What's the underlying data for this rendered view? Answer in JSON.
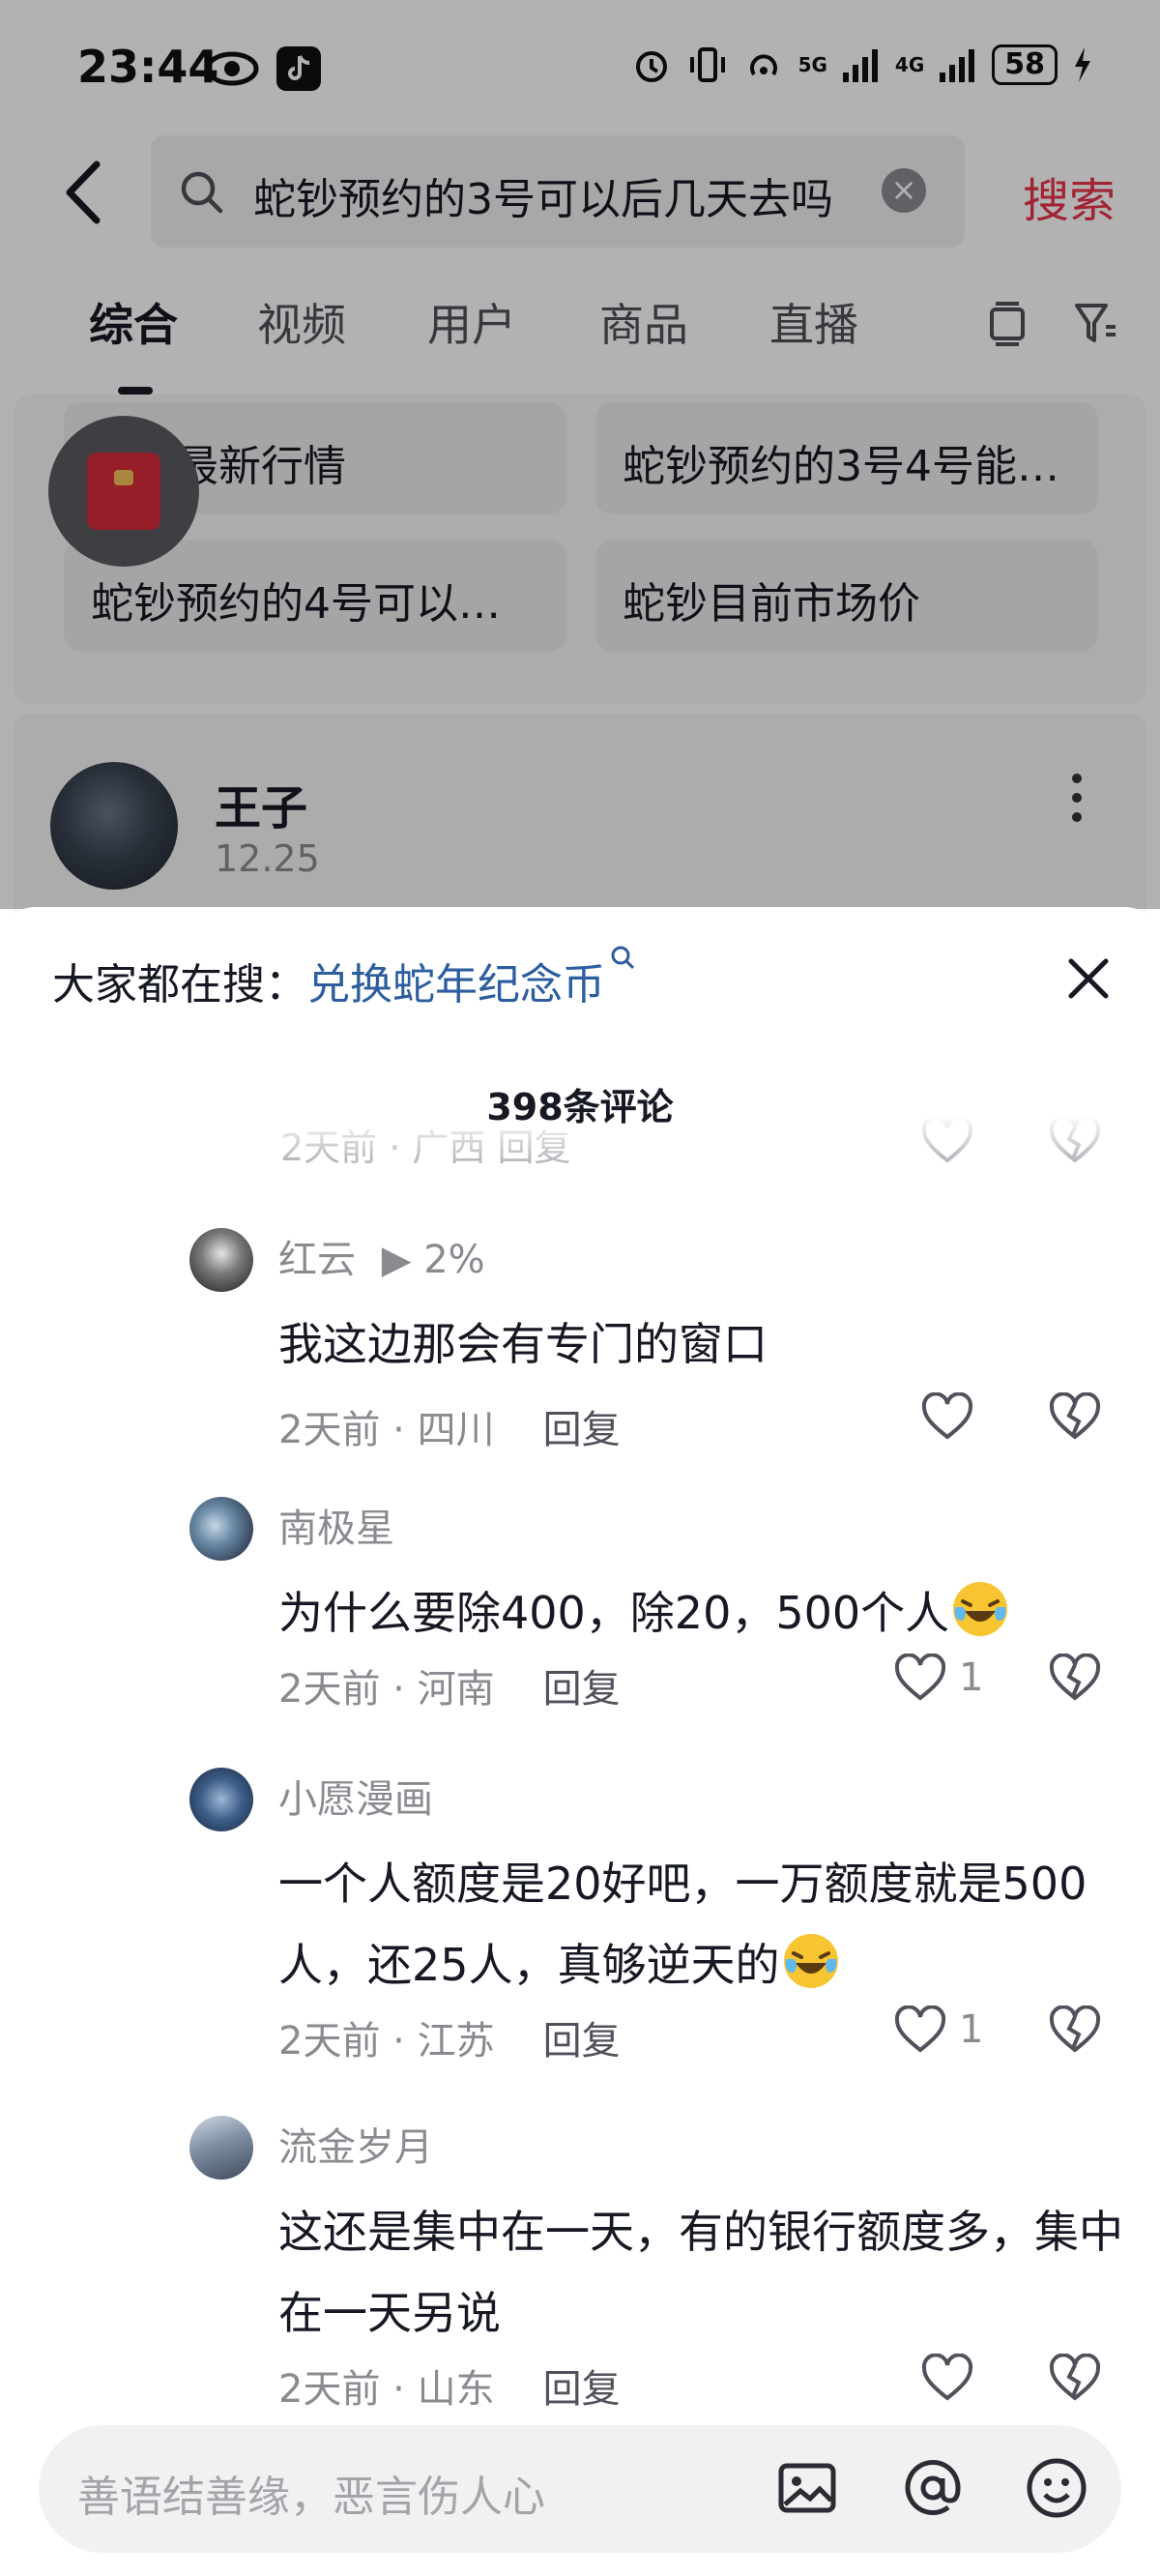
{
  "status_bar": {
    "time": "23:44",
    "battery": "58",
    "icons": [
      "eye-icon",
      "tiktok-icon",
      "alarm-icon",
      "vibrate-icon",
      "hotspot-icon",
      "signal-5g-icon",
      "signal-4g-icon",
      "charging-icon"
    ],
    "net1": "5G",
    "net2": "4G"
  },
  "search": {
    "query": "蛇钞预约的3号可以后几天去吗",
    "button": "搜索"
  },
  "tabs": [
    "综合",
    "视频",
    "用户",
    "商品",
    "直播"
  ],
  "suggestions": [
    "蛇币最新行情",
    "蛇钞预约的3号4号能…",
    "蛇钞预约的4号可以…",
    "蛇钞目前市场价"
  ],
  "post": {
    "author": "王子",
    "date": "12.25"
  },
  "sheet": {
    "trending_prefix": "大家都在搜：",
    "trending_link": "兑换蛇年纪念币",
    "comment_count": "398条评论",
    "ghost_meta": "2天前 · 广西    回复",
    "comments": [
      {
        "user": "红云",
        "badge": "▶ 2%",
        "text": "我这边那会有专门的窗口",
        "time": "2天前",
        "location": "四川",
        "reply": "回复",
        "likes": ""
      },
      {
        "user": "南极星",
        "badge": "",
        "text": "为什么要除400，除20，500个人",
        "time": "2天前",
        "location": "河南",
        "reply": "回复",
        "likes": "1"
      },
      {
        "user": "小愿漫画",
        "badge": "",
        "text": "一个人额度是20好吧，一万额度就是500人，还25人，真够逆天的",
        "time": "2天前",
        "location": "江苏",
        "reply": "回复",
        "likes": "1"
      },
      {
        "user": "流金岁月",
        "badge": "",
        "text": "这还是集中在一天，有的银行额度多，集中在一天另说",
        "time": "2天前",
        "location": "山东",
        "reply": "回复",
        "likes": ""
      }
    ]
  },
  "input": {
    "placeholder": "善语结善缘，恶言伤人心"
  },
  "colors": {
    "accent": "#e8334a",
    "link": "#2c5d9f",
    "muted": "#8a8b91"
  }
}
